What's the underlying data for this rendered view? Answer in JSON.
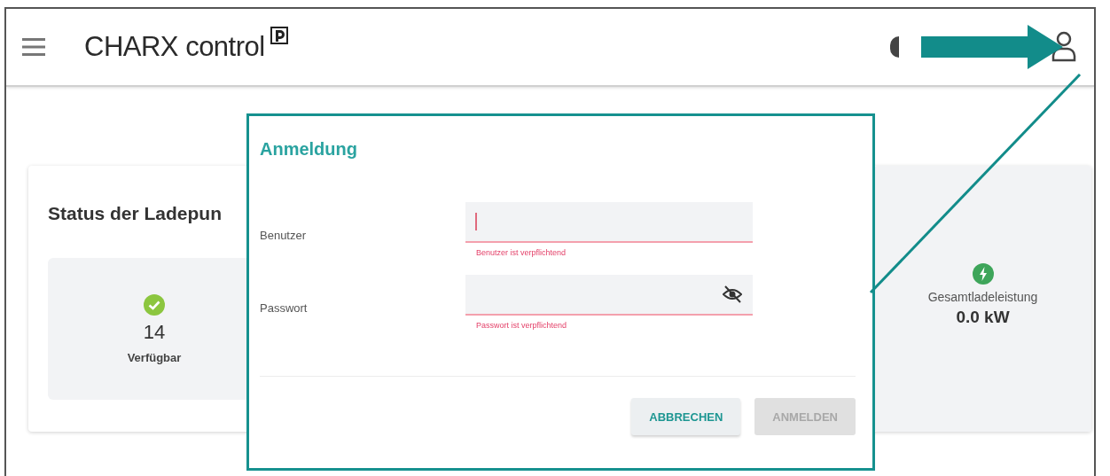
{
  "header": {
    "title": "CHARX control"
  },
  "status_card": {
    "title": "Status der Ladepun",
    "tiles": [
      {
        "kind": "available",
        "count": "14",
        "label": "Verfügbar"
      },
      {
        "kind": "power",
        "label": "Gesamtladeleistung",
        "value": "0.0 kW"
      }
    ]
  },
  "dialog": {
    "title": "Anmeldung",
    "fields": [
      {
        "label": "Benutzer",
        "kind": "text",
        "focused": true,
        "error": "Benutzer ist verpflichtend"
      },
      {
        "label": "Passwort",
        "kind": "password",
        "focused": false,
        "error": "Passwort ist verpflichtend"
      }
    ],
    "buttons": [
      {
        "label": "ABBRECHEN",
        "disabled": false
      },
      {
        "label": "ANMELDEN",
        "disabled": true
      }
    ]
  }
}
